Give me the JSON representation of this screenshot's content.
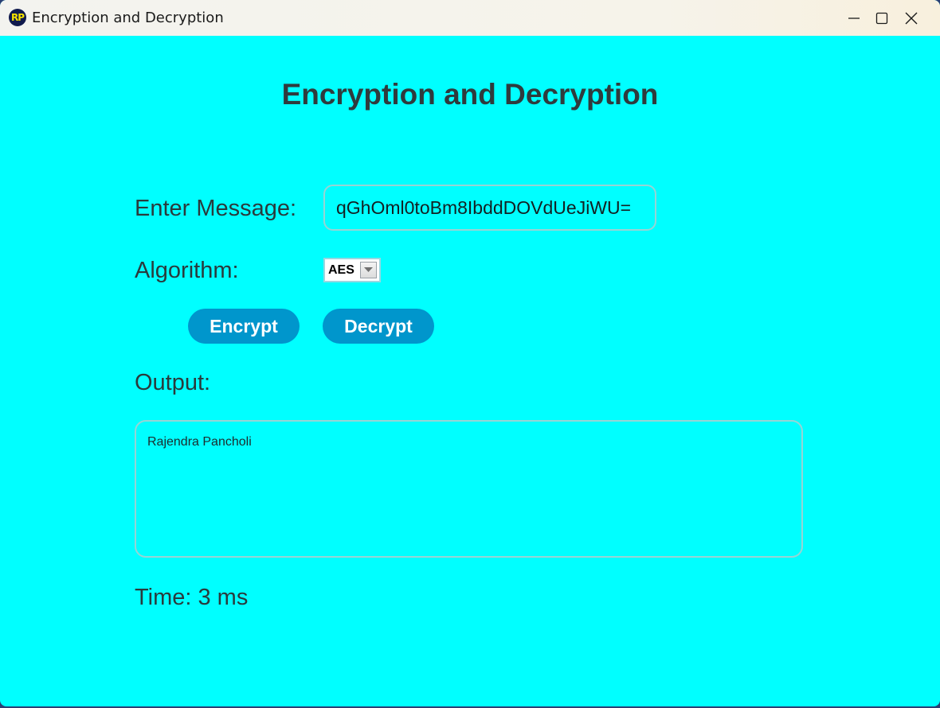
{
  "window": {
    "icon_text": "RP",
    "title": "Encryption and Decryption"
  },
  "main": {
    "heading": "Encryption and Decryption",
    "message_label": "Enter Message:",
    "message_value": "qGhOml0toBm8IbddDOVdUeJiWU=",
    "algorithm_label": "Algorithm:",
    "algorithm_selected": "AES",
    "encrypt_label": "Encrypt",
    "decrypt_label": "Decrypt",
    "output_label": "Output:",
    "output_value": "Rajendra Pancholi",
    "time_text": "Time: 3 ms"
  },
  "colors": {
    "background": "#00ffff",
    "button": "#0096cc",
    "text": "#2a3a3c"
  },
  "icons": [
    "minimize-icon",
    "maximize-icon",
    "close-icon",
    "chevron-down-icon"
  ]
}
